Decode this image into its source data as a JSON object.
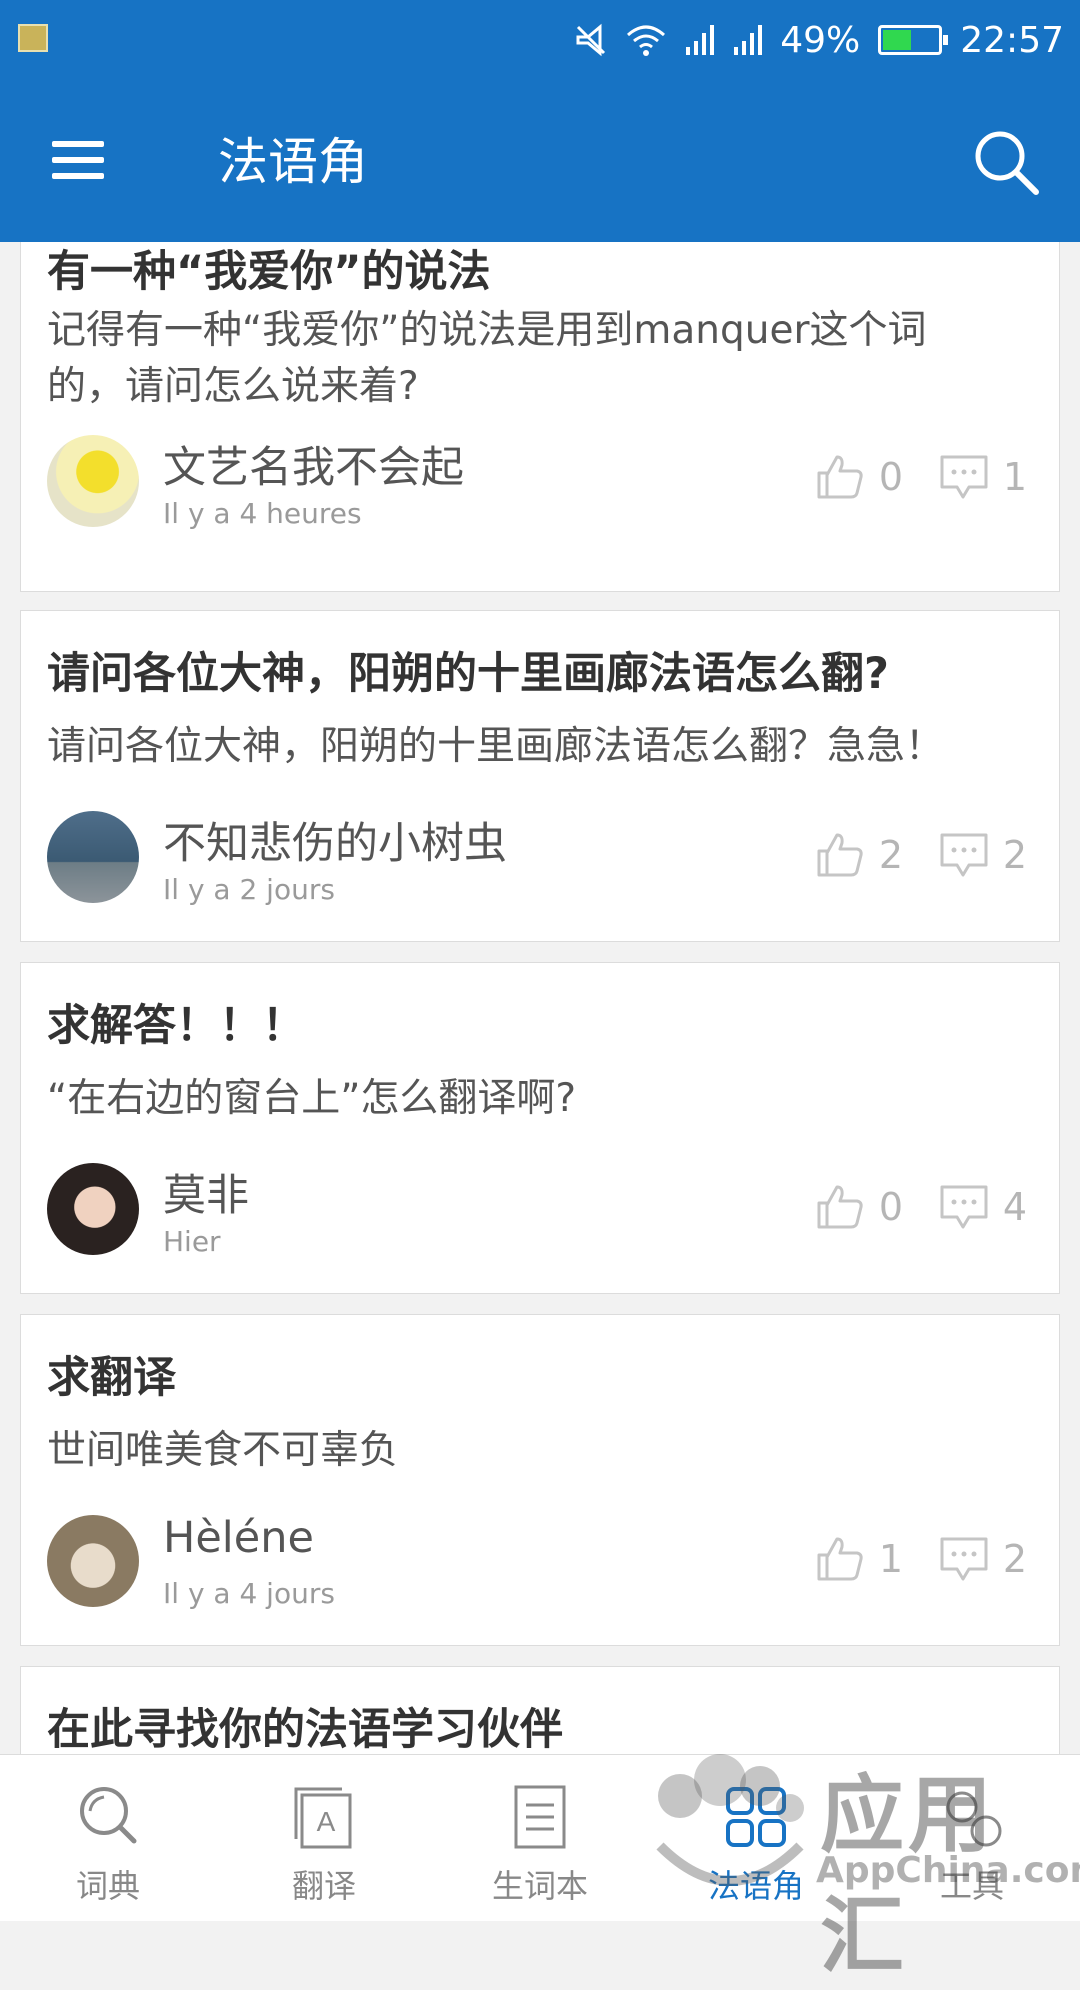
{
  "status_bar": {
    "battery": "49%",
    "time": "22:57"
  },
  "toolbar": {
    "title": "法语角"
  },
  "posts": [
    {
      "title": "有一种“我爱你”的说法",
      "body": "记得有一种“我爱你”的说法是用到manquer这个词的，请问怎么说来着?",
      "author": "文艺名我不会起",
      "time": "Il y a 4 heures",
      "likes": "0",
      "comments": "1"
    },
    {
      "title": "请问各位大神，阳朔的十里画廊法语怎么翻?",
      "body": "请问各位大神，阳朔的十里画廊法语怎么翻？急急！",
      "author": "不知悲伤的小树虫",
      "time": "Il y a 2 jours",
      "likes": "2",
      "comments": "2"
    },
    {
      "title": "求解答！！！",
      "body": "“在右边的窗台上”怎么翻译啊?",
      "author": "莫非",
      "time": "Hier",
      "likes": "0",
      "comments": "4"
    },
    {
      "title": "求翻译",
      "body": "世间唯美食不可辜负",
      "author": "Hèléne",
      "time": "Il y a 4 jours",
      "likes": "1",
      "comments": "2"
    },
    {
      "title": "在此寻找你的法语学习伙伴"
    }
  ],
  "bottom_nav": [
    {
      "label": "词典",
      "icon": "search-icon"
    },
    {
      "label": "翻译",
      "icon": "translate-icon"
    },
    {
      "label": "生词本",
      "icon": "notebook-icon"
    },
    {
      "label": "法语角",
      "icon": "grid-icon",
      "active": true
    },
    {
      "label": "工具",
      "icon": "tools-icon"
    }
  ],
  "watermark": {
    "text": "应用汇",
    "sub": "AppChina.com"
  },
  "colors": {
    "brand": "#1773c4",
    "background": "#f2f2f2"
  }
}
